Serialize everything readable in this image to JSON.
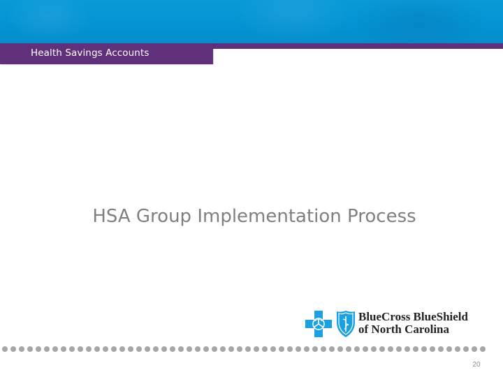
{
  "header": {
    "section_label": "Health Savings Accounts",
    "colors": {
      "banner_blue": "#0393d3",
      "band_purple": "#61307a"
    }
  },
  "slide": {
    "title": "HSA Group Implementation Process",
    "title_color": "#7f7f7f"
  },
  "logo": {
    "line1": "BlueCross BlueShield",
    "line2": "of North Carolina",
    "icons": [
      "blue-cross-icon",
      "blue-shield-icon"
    ],
    "brand_blue": "#1ba1e2"
  },
  "footer": {
    "dot_count": 58,
    "dot_color": "#a6a6a6",
    "page_number": "20"
  }
}
